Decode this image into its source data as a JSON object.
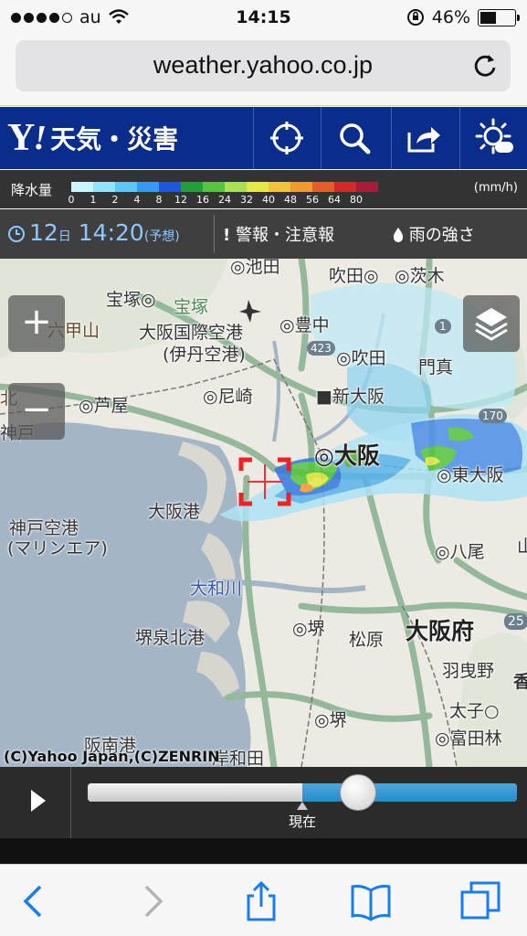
{
  "status_bar": {
    "carrier": "au",
    "time": "14:15",
    "battery": "46%"
  },
  "browser": {
    "url": "weather.yahoo.co.jp"
  },
  "header": {
    "logo_y": "Y",
    "logo_ex": "!",
    "title": "天気・災害"
  },
  "legend": {
    "label": "降水量",
    "unit": "(mm/h)",
    "levels": [
      "0",
      "1",
      "2",
      "4",
      "8",
      "12",
      "16",
      "24",
      "32",
      "40",
      "48",
      "56",
      "64",
      "80"
    ],
    "colors": [
      "#c9f6ff",
      "#8de5ff",
      "#59c8ff",
      "#2f9bff",
      "#1f55e8",
      "#1ea13b",
      "#53c63d",
      "#a6e34c",
      "#e6ea3e",
      "#f2c633",
      "#f39a27",
      "#ee5a26",
      "#d7262a",
      "#b0183a"
    ]
  },
  "info_bar": {
    "day": "12",
    "day_suffix": "日",
    "time": "14:20",
    "forecast": "(予想)",
    "alert": "警報・注意報",
    "rain_strength": "雨の強さ"
  },
  "map": {
    "labels": {
      "ikeda": "池田",
      "suita_n": "吹田",
      "ibaraki_n": "茨木",
      "ibaraki_top": "茨木",
      "takarazuka_a": "宝塚",
      "takarazuka_b": "宝塚",
      "rokko": "六甲山",
      "airport1": "大阪国際空港",
      "airport2": "(伊丹空港)",
      "toyonaka": "豊中",
      "suita": "吹田",
      "kadoma": "門真",
      "shinosaka": "新大阪",
      "ashiya": "芦屋",
      "amagasaki": "尼崎",
      "osaka": "大阪",
      "higashiosaka": "東大阪",
      "osakako": "大阪港",
      "kobe1": "神戸空港",
      "kobe2": "(マリンエア)",
      "yao": "八尾",
      "yamatogawa": "大和川",
      "sakaisenboku": "堺泉北港",
      "sakai": "堺",
      "matsubara": "松原",
      "osakafu": "大阪府",
      "habikino": "羽曳野",
      "taishi": "太子",
      "sakai2": "堺",
      "tondabayashi": "富田林",
      "hannanko": "阪南港",
      "kishiwada": "岸和田",
      "kobe_edge": "神戸",
      "kita": "北",
      "kuramayama": "山",
      "route423": "423",
      "route1": "1",
      "route170": "170",
      "route25": "25",
      "kashiwara": "香"
    },
    "copyright": "(C)Yahoo Japan,(C)ZENRIN",
    "zoom_in": "+",
    "zoom_out": "−"
  },
  "timeline": {
    "now_label": "現在",
    "progress_percent": 63,
    "now_percent": 50
  }
}
